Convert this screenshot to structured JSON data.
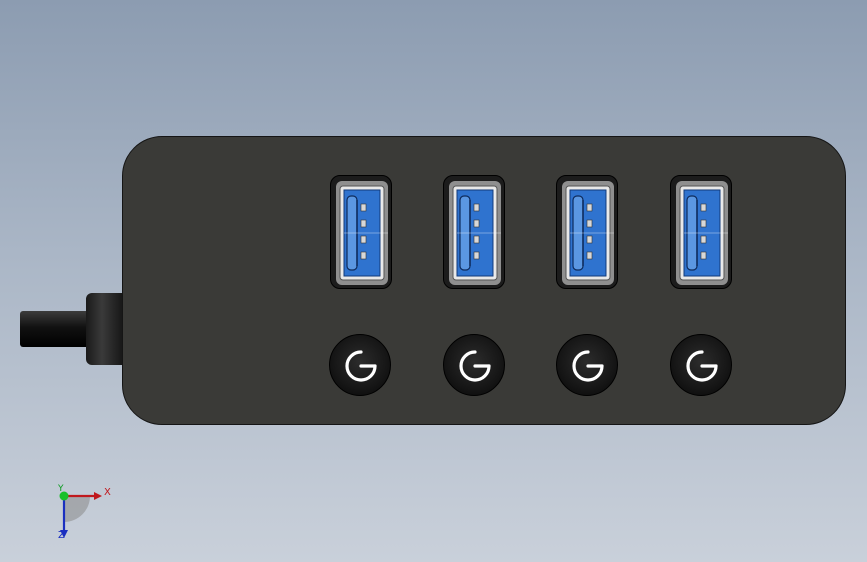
{
  "scene": {
    "background_top": "#8c9cb1",
    "background_bottom": "#c9d0da"
  },
  "hub": {
    "body_color": "#3a3a37",
    "port_count": 4,
    "port_insert_color": "#2f73cf",
    "power_button_count": 4,
    "power_icon": "power-icon"
  },
  "triad": {
    "x_label": "X",
    "y_label": "Y",
    "z_label": "Z",
    "x_color": "#c0181d",
    "y_color": "#0a9a1f",
    "z_color": "#1a2fc0"
  }
}
